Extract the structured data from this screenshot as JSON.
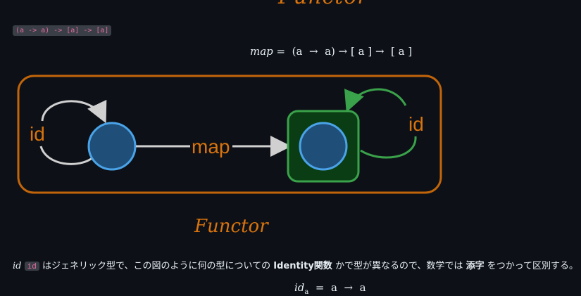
{
  "top_heading": "Functor",
  "signature_code": "(a -> a) -> [a] -> [a]",
  "formula_map": {
    "name": "map",
    "rest": " =  (a  →  a) → [ a ] →  [ a ]"
  },
  "diagram": {
    "left_loop_label": "id",
    "arrow_label": "map",
    "right_loop_label": "id",
    "colors": {
      "frame": "#c2650a",
      "node_fill": "#1f4e79",
      "node_stroke": "#4aa3e8",
      "box_fill": "#0b3d14",
      "box_stroke": "#3aa24a",
      "left_loop": "#d0d0d0",
      "right_loop": "#3aa24a",
      "label": "#d9730d"
    }
  },
  "caption": "Functor",
  "paragraph": {
    "italic_id": "id",
    "code_id": "id",
    "text1": " はジェネリック型で、この図のように何の型についての ",
    "bold1": "Identity関数",
    "text2": " かで型が異なるので、数学では ",
    "bold2": "添字",
    "text3": " をつかって区別する。"
  },
  "formula_id": {
    "name": "id",
    "sub": "a",
    "rest": "  =  a  →  a"
  }
}
